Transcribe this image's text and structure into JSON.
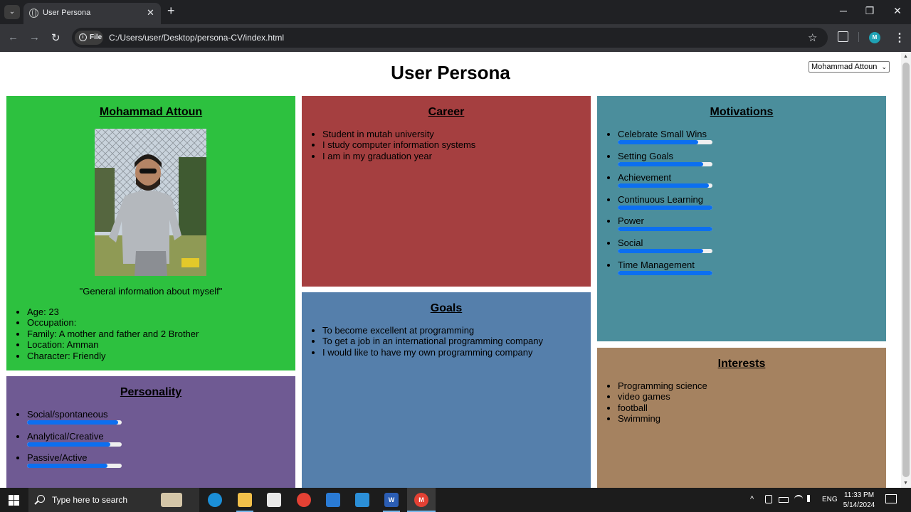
{
  "browser": {
    "tab_list_glyph": "⌄",
    "tab_title": "User Persona",
    "tab_close_glyph": "✕",
    "new_tab_glyph": "+",
    "window_controls": {
      "minimize": "─",
      "maximize": "❐",
      "close": "✕"
    },
    "nav": {
      "back": "←",
      "forward": "→",
      "reload": "↻"
    },
    "url_chip_icon": "i",
    "url_chip_label": "File",
    "url": "C:/Users/user/Desktop/persona-CV/index.html",
    "bookmark_glyph": "☆",
    "profile_initial": "M",
    "menu_glyph": "⋮",
    "scroll_up_glyph": "▲",
    "scroll_down_glyph": "▼"
  },
  "page": {
    "title": "User Persona",
    "persona_select": {
      "value": "Mohammad Attoun",
      "caret": "⌄"
    }
  },
  "profile": {
    "name": "Mohammad Attoun",
    "quote": "\"General information about myself\"",
    "details": [
      "Age: 23",
      "Occupation:",
      "Family: A mother and father and 2 Brother",
      "Location: Amman",
      "Character: Friendly"
    ]
  },
  "personality": {
    "title": "Personality",
    "traits": [
      {
        "label": "Social/spontaneous",
        "level": 0.96
      },
      {
        "label": "Analytical/Creative",
        "level": 0.88
      },
      {
        "label": "Passive/Active",
        "level": 0.85
      }
    ]
  },
  "career": {
    "title": "Career",
    "items": [
      "Student in mutah university",
      "I study computer information systems",
      "I am in my graduation year"
    ]
  },
  "goals": {
    "title": "Goals",
    "items": [
      "To become excellent at programming",
      "To get a job in an international programming company",
      "I would like to have my own programming company"
    ]
  },
  "motivations": {
    "title": "Motivations",
    "items": [
      {
        "label": "Celebrate Small Wins",
        "level": 0.85
      },
      {
        "label": "Setting Goals",
        "level": 0.9
      },
      {
        "label": "Achievement",
        "level": 0.96
      },
      {
        "label": "Continuous Learning",
        "level": 1.0
      },
      {
        "label": "Power",
        "level": 1.0
      },
      {
        "label": "Social",
        "level": 0.9
      },
      {
        "label": "Time Management",
        "level": 1.0
      }
    ]
  },
  "interests": {
    "title": "Interests",
    "items": [
      "Programming science",
      "video games",
      "football",
      "Swimming"
    ]
  },
  "taskbar": {
    "search_placeholder": "Type here to search",
    "tray_caret": "^",
    "language": "ENG",
    "time": "11:33 PM",
    "date": "5/14/2024",
    "word_icon_label": "W",
    "chrome_badge": "M"
  },
  "colors": {
    "profile": "#2dc13f",
    "personality": "#6f5a93",
    "career": "#a53f40",
    "goals": "#557fab",
    "motivations": "#4b8e9c",
    "interests": "#a58260",
    "meter": "#0c6ff0"
  }
}
